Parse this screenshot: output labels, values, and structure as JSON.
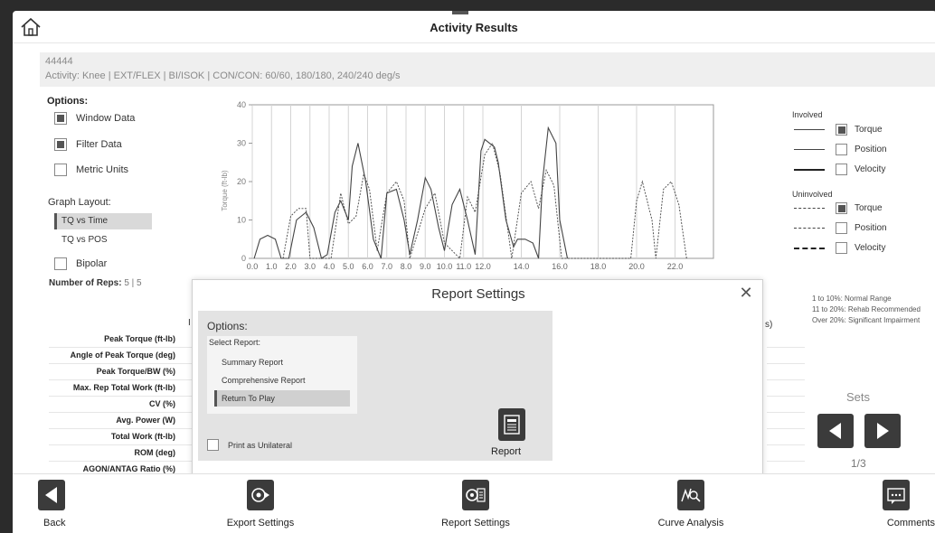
{
  "header": {
    "title": "Activity Results"
  },
  "banner": {
    "id": "44444",
    "activity": "Activity: Knee | EXT/FLEX | BI/ISOK | CON/CON: 60/60, 180/180, 240/240 deg/s"
  },
  "options": {
    "title": "Options:",
    "window_data": {
      "label": "Window Data",
      "checked": true
    },
    "filter_data": {
      "label": "Filter Data",
      "checked": true
    },
    "metric_units": {
      "label": "Metric Units",
      "checked": false
    },
    "graph_layout_label": "Graph Layout:",
    "graph_layout_items": [
      "TQ vs Time",
      "TQ vs POS"
    ],
    "graph_layout_selected": "TQ vs Time",
    "bipolar": {
      "label": "Bipolar",
      "checked": false
    }
  },
  "chart_data": {
    "type": "line",
    "xlabel": "",
    "ylabel": "Torque (ft-lb)",
    "xlim": [
      0,
      24
    ],
    "ylim": [
      0,
      40
    ],
    "x_ticks": [
      "0.0",
      "1.0",
      "2.0",
      "3.0",
      "4.0",
      "5.0",
      "6.0",
      "7.0",
      "8.0",
      "9.0",
      "10.0",
      "11.0",
      "12.0",
      "14.0",
      "16.0",
      "18.0",
      "20.0",
      "22.0"
    ],
    "y_ticks": [
      0,
      10,
      20,
      30,
      40
    ],
    "grid": "vertical",
    "series": [
      {
        "style": "solid",
        "points": [
          [
            0.1,
            0
          ],
          [
            0.4,
            5
          ],
          [
            0.8,
            6
          ],
          [
            1.2,
            5
          ],
          [
            1.5,
            0
          ],
          [
            1.9,
            0
          ],
          [
            2.3,
            10
          ],
          [
            2.8,
            12
          ],
          [
            3.2,
            8
          ],
          [
            3.6,
            0
          ],
          [
            3.9,
            1
          ],
          [
            4.3,
            12
          ],
          [
            4.6,
            15
          ],
          [
            5.0,
            10
          ],
          [
            5.2,
            24
          ],
          [
            5.5,
            30
          ],
          [
            5.9,
            20
          ],
          [
            6.3,
            5
          ],
          [
            6.7,
            0
          ],
          [
            7.0,
            17
          ],
          [
            7.5,
            18
          ],
          [
            7.9,
            10
          ],
          [
            8.2,
            1
          ],
          [
            8.6,
            10
          ],
          [
            9.0,
            21
          ],
          [
            9.3,
            18
          ],
          [
            9.7,
            8
          ],
          [
            10.0,
            2
          ],
          [
            10.4,
            14
          ],
          [
            10.8,
            18
          ],
          [
            11.2,
            10
          ],
          [
            11.6,
            1
          ],
          [
            11.9,
            28
          ],
          [
            12.1,
            31
          ],
          [
            12.6,
            29
          ],
          [
            12.8,
            25
          ],
          [
            13.2,
            10
          ],
          [
            13.6,
            3
          ],
          [
            13.8,
            5
          ],
          [
            14.2,
            5
          ],
          [
            14.6,
            4
          ],
          [
            14.9,
            0
          ],
          [
            15.1,
            20
          ],
          [
            15.4,
            34
          ],
          [
            15.8,
            30
          ],
          [
            16.0,
            10
          ],
          [
            16.4,
            0
          ]
        ]
      },
      {
        "style": "dashed",
        "points": [
          [
            1.6,
            0
          ],
          [
            2.0,
            11
          ],
          [
            2.4,
            13
          ],
          [
            2.8,
            13
          ],
          [
            3.0,
            0
          ],
          [
            4.1,
            0
          ],
          [
            4.6,
            17
          ],
          [
            5.0,
            9
          ],
          [
            5.4,
            11
          ],
          [
            5.8,
            22
          ],
          [
            6.1,
            18
          ],
          [
            6.5,
            2
          ],
          [
            7.0,
            17
          ],
          [
            7.5,
            20
          ],
          [
            7.9,
            15
          ],
          [
            8.2,
            0
          ],
          [
            9.0,
            13
          ],
          [
            9.5,
            17
          ],
          [
            10.0,
            4
          ],
          [
            10.8,
            0
          ],
          [
            11.2,
            16
          ],
          [
            11.6,
            12
          ],
          [
            12.1,
            27
          ],
          [
            12.5,
            30
          ],
          [
            12.9,
            22
          ],
          [
            13.5,
            0
          ],
          [
            14.0,
            17
          ],
          [
            14.5,
            20
          ],
          [
            14.9,
            13
          ],
          [
            15.3,
            23
          ],
          [
            15.7,
            19
          ],
          [
            16.1,
            0
          ],
          [
            19.7,
            0
          ],
          [
            20.0,
            15
          ],
          [
            20.3,
            20
          ],
          [
            20.8,
            10
          ],
          [
            21.0,
            0
          ],
          [
            21.4,
            18
          ],
          [
            21.8,
            20
          ],
          [
            22.2,
            14
          ],
          [
            22.6,
            0
          ]
        ]
      }
    ]
  },
  "legend": {
    "involved": "Involved",
    "uninvolved": "Uninvolved",
    "items": [
      {
        "label": "Torque",
        "checked": true
      },
      {
        "label": "Position",
        "checked": false
      },
      {
        "label": "Velocity",
        "checked": false
      }
    ]
  },
  "reps": {
    "label": "Number of Reps:",
    "value": "5 | 5"
  },
  "metrics": [
    "Peak Torque (ft-lb)",
    "Angle of Peak Torque (deg)",
    "Peak Torque/BW (%)",
    "Max. Rep Total Work (ft-lb)",
    "CV (%)",
    "Avg. Power (W)",
    "Total Work (ft-lb)",
    "ROM (deg)",
    "AGON/ANTAG Ratio (%)"
  ],
  "table_fragments": {
    "left_char": "I",
    "right_char": "s)"
  },
  "scale_legend": [
    "1 to 10%: Normal Range",
    "11 to 20%: Rehab Recommended",
    "Over 20%: Significant Impairment"
  ],
  "sets": {
    "label": "Sets",
    "count": "1/3"
  },
  "modal": {
    "title": "Report Settings",
    "options_label": "Options:",
    "select_report_label": "Select Report:",
    "reports": [
      "Summary Report",
      "Comprehensive Report",
      "Return To Play"
    ],
    "selected_report": "Return To Play",
    "print_unilateral": {
      "label": "Print as Unilateral",
      "checked": false
    },
    "report_button_label": "Report"
  },
  "footer": {
    "back": "Back",
    "export_settings": "Export Settings",
    "report_settings": "Report Settings",
    "curve_analysis": "Curve Analysis",
    "comments": "Comments"
  }
}
